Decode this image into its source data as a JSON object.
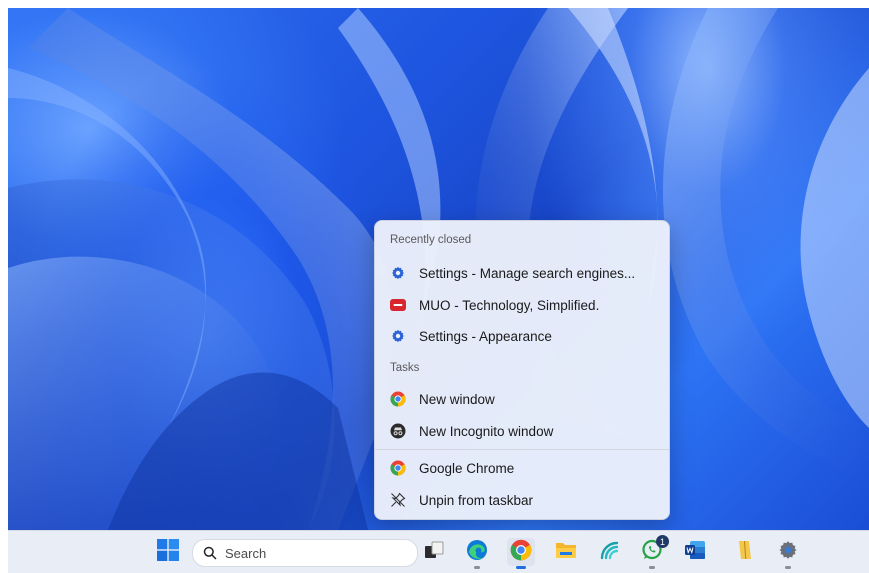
{
  "menu": {
    "recently_closed_header": "Recently closed",
    "recent_items": [
      {
        "label": "Settings - Manage search engines...",
        "icon": "settings-gear-icon"
      },
      {
        "label": "MUO - Technology, Simplified.",
        "icon": "muo-favicon-icon"
      },
      {
        "label": "Settings - Appearance",
        "icon": "settings-gear-icon"
      }
    ],
    "tasks_header": "Tasks",
    "task_items": [
      {
        "label": "New window",
        "icon": "chrome-icon"
      },
      {
        "label": "New Incognito window",
        "icon": "incognito-icon"
      }
    ],
    "app_items": [
      {
        "label": "Google Chrome",
        "icon": "chrome-icon"
      },
      {
        "label": "Unpin from taskbar",
        "icon": "unpin-icon"
      }
    ]
  },
  "taskbar": {
    "search_placeholder": "Search",
    "whatsapp_badge": "1",
    "apps": [
      "start-icon",
      "search-icon",
      "task-view-icon",
      "edge-icon",
      "chrome-icon",
      "file-explorer-icon",
      "network-app-icon",
      "whatsapp-icon",
      "word-icon",
      "winzip-icon",
      "settings-icon"
    ]
  },
  "colors": {
    "wallpaper_primary": "#1e55e0",
    "menu_background": "#ecf0fa",
    "taskbar_background": "#e9edf6",
    "chrome_red": "#ea4335",
    "chrome_green": "#34a853",
    "chrome_yellow": "#fbbc05",
    "chrome_blue": "#4285f4"
  }
}
